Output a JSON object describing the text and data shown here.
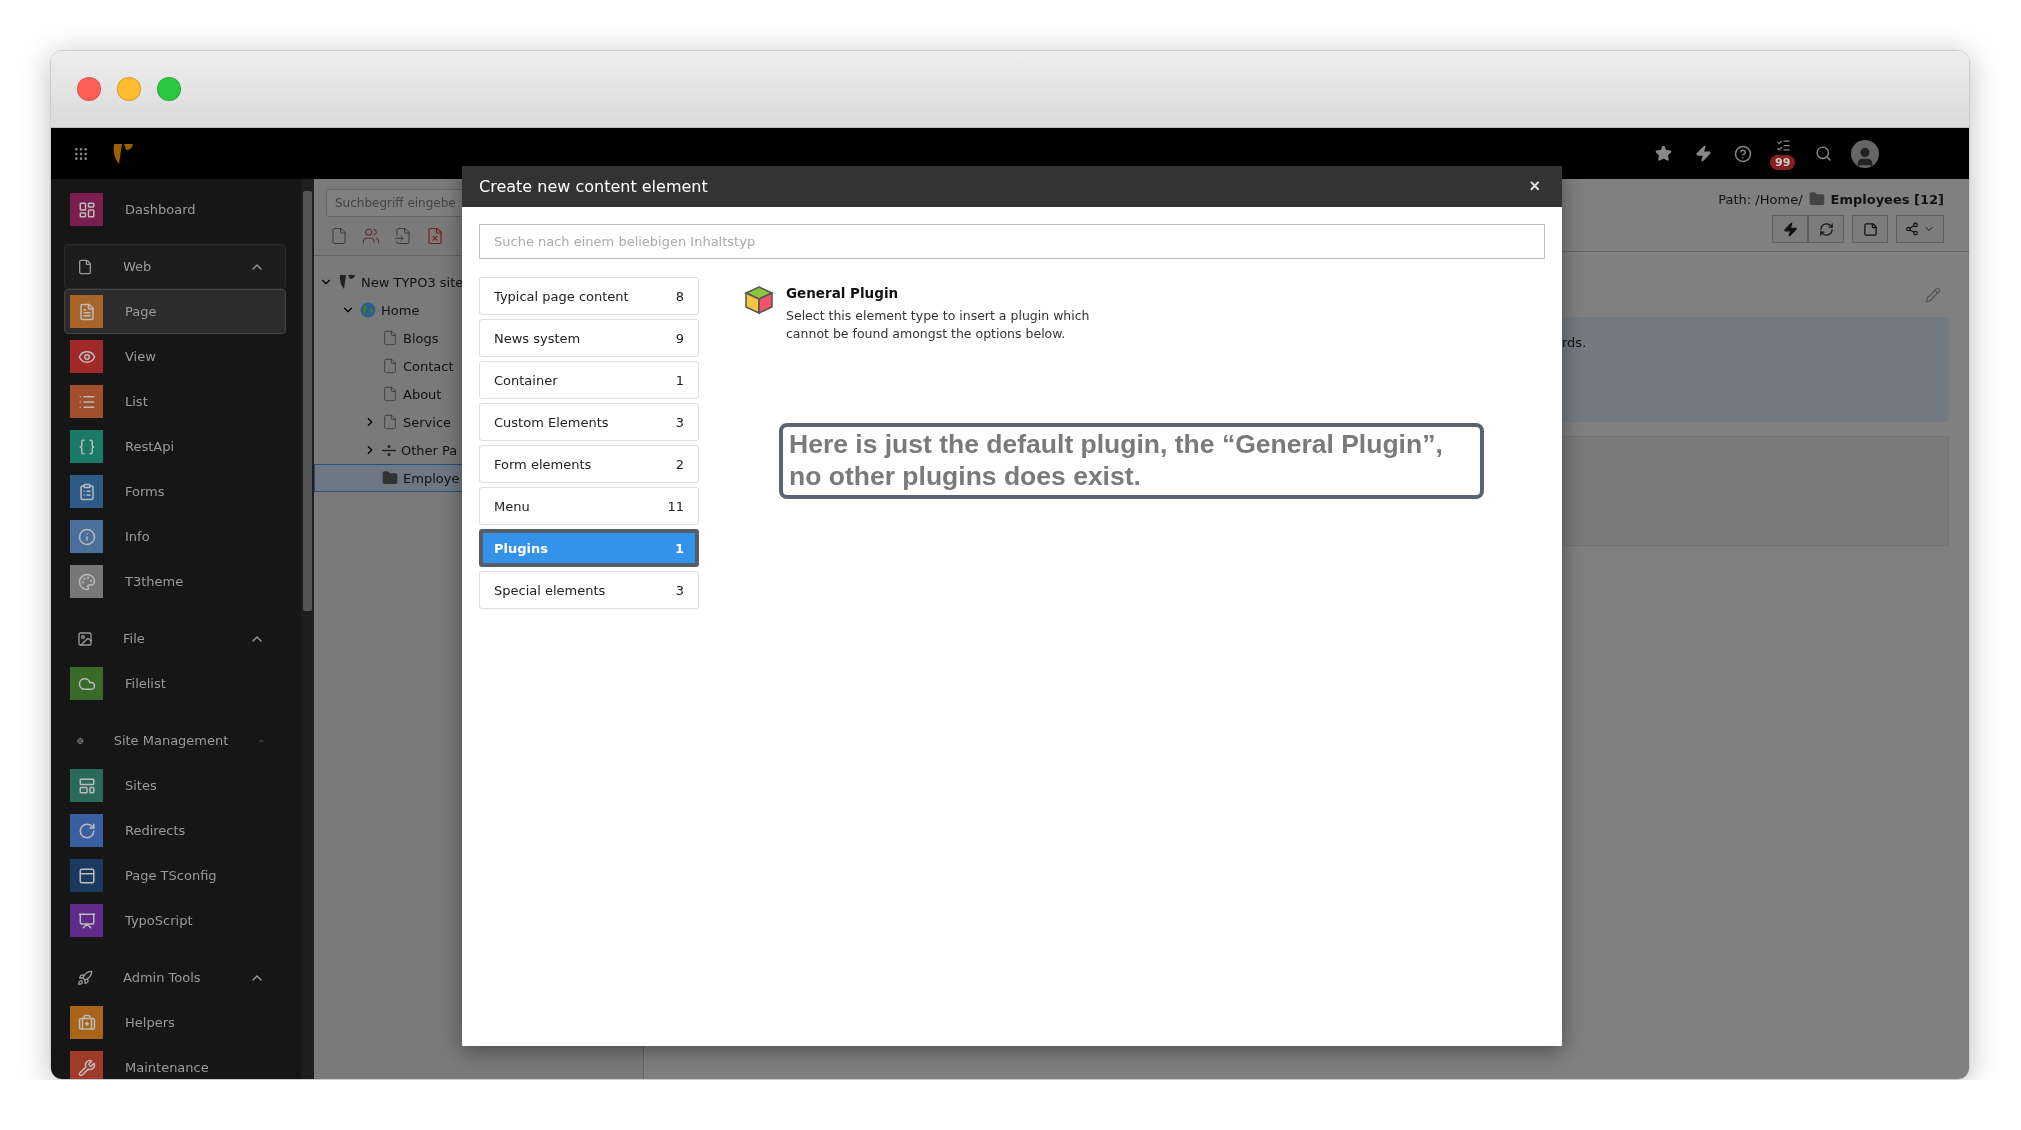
{
  "topbar": {
    "notification_count": "99"
  },
  "sidebar": {
    "items": [
      {
        "kind": "module",
        "label": "Dashboard",
        "color": "#7a1e50",
        "selected": false
      },
      {
        "kind": "group",
        "label": "Web",
        "active": true,
        "expanded": true
      },
      {
        "kind": "module",
        "label": "Page",
        "color": "#a8652a",
        "selected": true
      },
      {
        "kind": "module",
        "label": "View",
        "color": "#a02a2a",
        "selected": false
      },
      {
        "kind": "module",
        "label": "List",
        "color": "#a04f2a",
        "selected": false
      },
      {
        "kind": "module",
        "label": "RestApi",
        "color": "#1a7a68",
        "selected": false
      },
      {
        "kind": "module",
        "label": "Forms",
        "color": "#2d5a86",
        "selected": false
      },
      {
        "kind": "module",
        "label": "Info",
        "color": "#4a6f9a",
        "selected": false
      },
      {
        "kind": "module",
        "label": "T3theme",
        "color": "#777777",
        "selected": false
      },
      {
        "kind": "group",
        "label": "File",
        "active": false,
        "expanded": true
      },
      {
        "kind": "module",
        "label": "Filelist",
        "color": "#3a6a2a",
        "selected": false
      },
      {
        "kind": "group",
        "label": "Site Management",
        "active": false,
        "expanded": true
      },
      {
        "kind": "module",
        "label": "Sites",
        "color": "#2a6a5a",
        "selected": false
      },
      {
        "kind": "module",
        "label": "Redirects",
        "color": "#3a5fa0",
        "selected": false
      },
      {
        "kind": "module",
        "label": "Page TSconfig",
        "color": "#1a3a60",
        "selected": false
      },
      {
        "kind": "module",
        "label": "TypoScript",
        "color": "#5f2a8a",
        "selected": false
      },
      {
        "kind": "group",
        "label": "Admin Tools",
        "active": false,
        "expanded": true
      },
      {
        "kind": "module",
        "label": "Helpers",
        "color": "#a8651a",
        "selected": false
      },
      {
        "kind": "module",
        "label": "Maintenance",
        "color": "#a03a2a",
        "selected": false
      }
    ]
  },
  "page_tree": {
    "search": {
      "placeholder": "Suchbegriff eingebe"
    },
    "nodes": [
      {
        "kind": "site",
        "label": "New TYPO3 site",
        "expanded": true,
        "selected": false,
        "children": [
          {
            "kind": "home",
            "label": "Home",
            "expanded": true,
            "selected": false,
            "children": [
              {
                "kind": "page",
                "label": "Blogs",
                "selected": false
              },
              {
                "kind": "page",
                "label": "Contact",
                "selected": false
              },
              {
                "kind": "page",
                "label": "About",
                "selected": false
              },
              {
                "kind": "page",
                "label": "Service",
                "expanded": false,
                "selected": false
              },
              {
                "kind": "separator",
                "label": "Other Pa",
                "expanded": false,
                "selected": false
              },
              {
                "kind": "folder",
                "label": "Employe",
                "selected": true
              }
            ]
          }
        ]
      }
    ]
  },
  "content": {
    "path_label": "Path: /Home/",
    "page_title": "Employees [12]",
    "info_text": "rds."
  },
  "modal": {
    "title": "Create new content element",
    "close": "×",
    "search": {
      "placeholder": "Suche nach einem beliebigen Inhaltstyp"
    },
    "categories": [
      {
        "label": "Typical page content",
        "count": "8",
        "selected": false,
        "annotated": false
      },
      {
        "label": "News system",
        "count": "9",
        "selected": false,
        "annotated": false
      },
      {
        "label": "Container",
        "count": "1",
        "selected": false,
        "annotated": false
      },
      {
        "label": "Custom Elements",
        "count": "3",
        "selected": false,
        "annotated": false
      },
      {
        "label": "Form elements",
        "count": "2",
        "selected": false,
        "annotated": false
      },
      {
        "label": "Menu",
        "count": "11",
        "selected": false,
        "annotated": false
      },
      {
        "label": "Plugins",
        "count": "1",
        "selected": true,
        "annotated": true
      },
      {
        "label": "Special elements",
        "count": "3",
        "selected": false,
        "annotated": false
      }
    ],
    "elements": [
      {
        "title": "General Plugin",
        "description": "Select this element type to insert a plugin which cannot be found amongst the options below."
      }
    ],
    "annotation": "Here is just the default plugin, the “General Plugin”, no other plugins does exist."
  }
}
